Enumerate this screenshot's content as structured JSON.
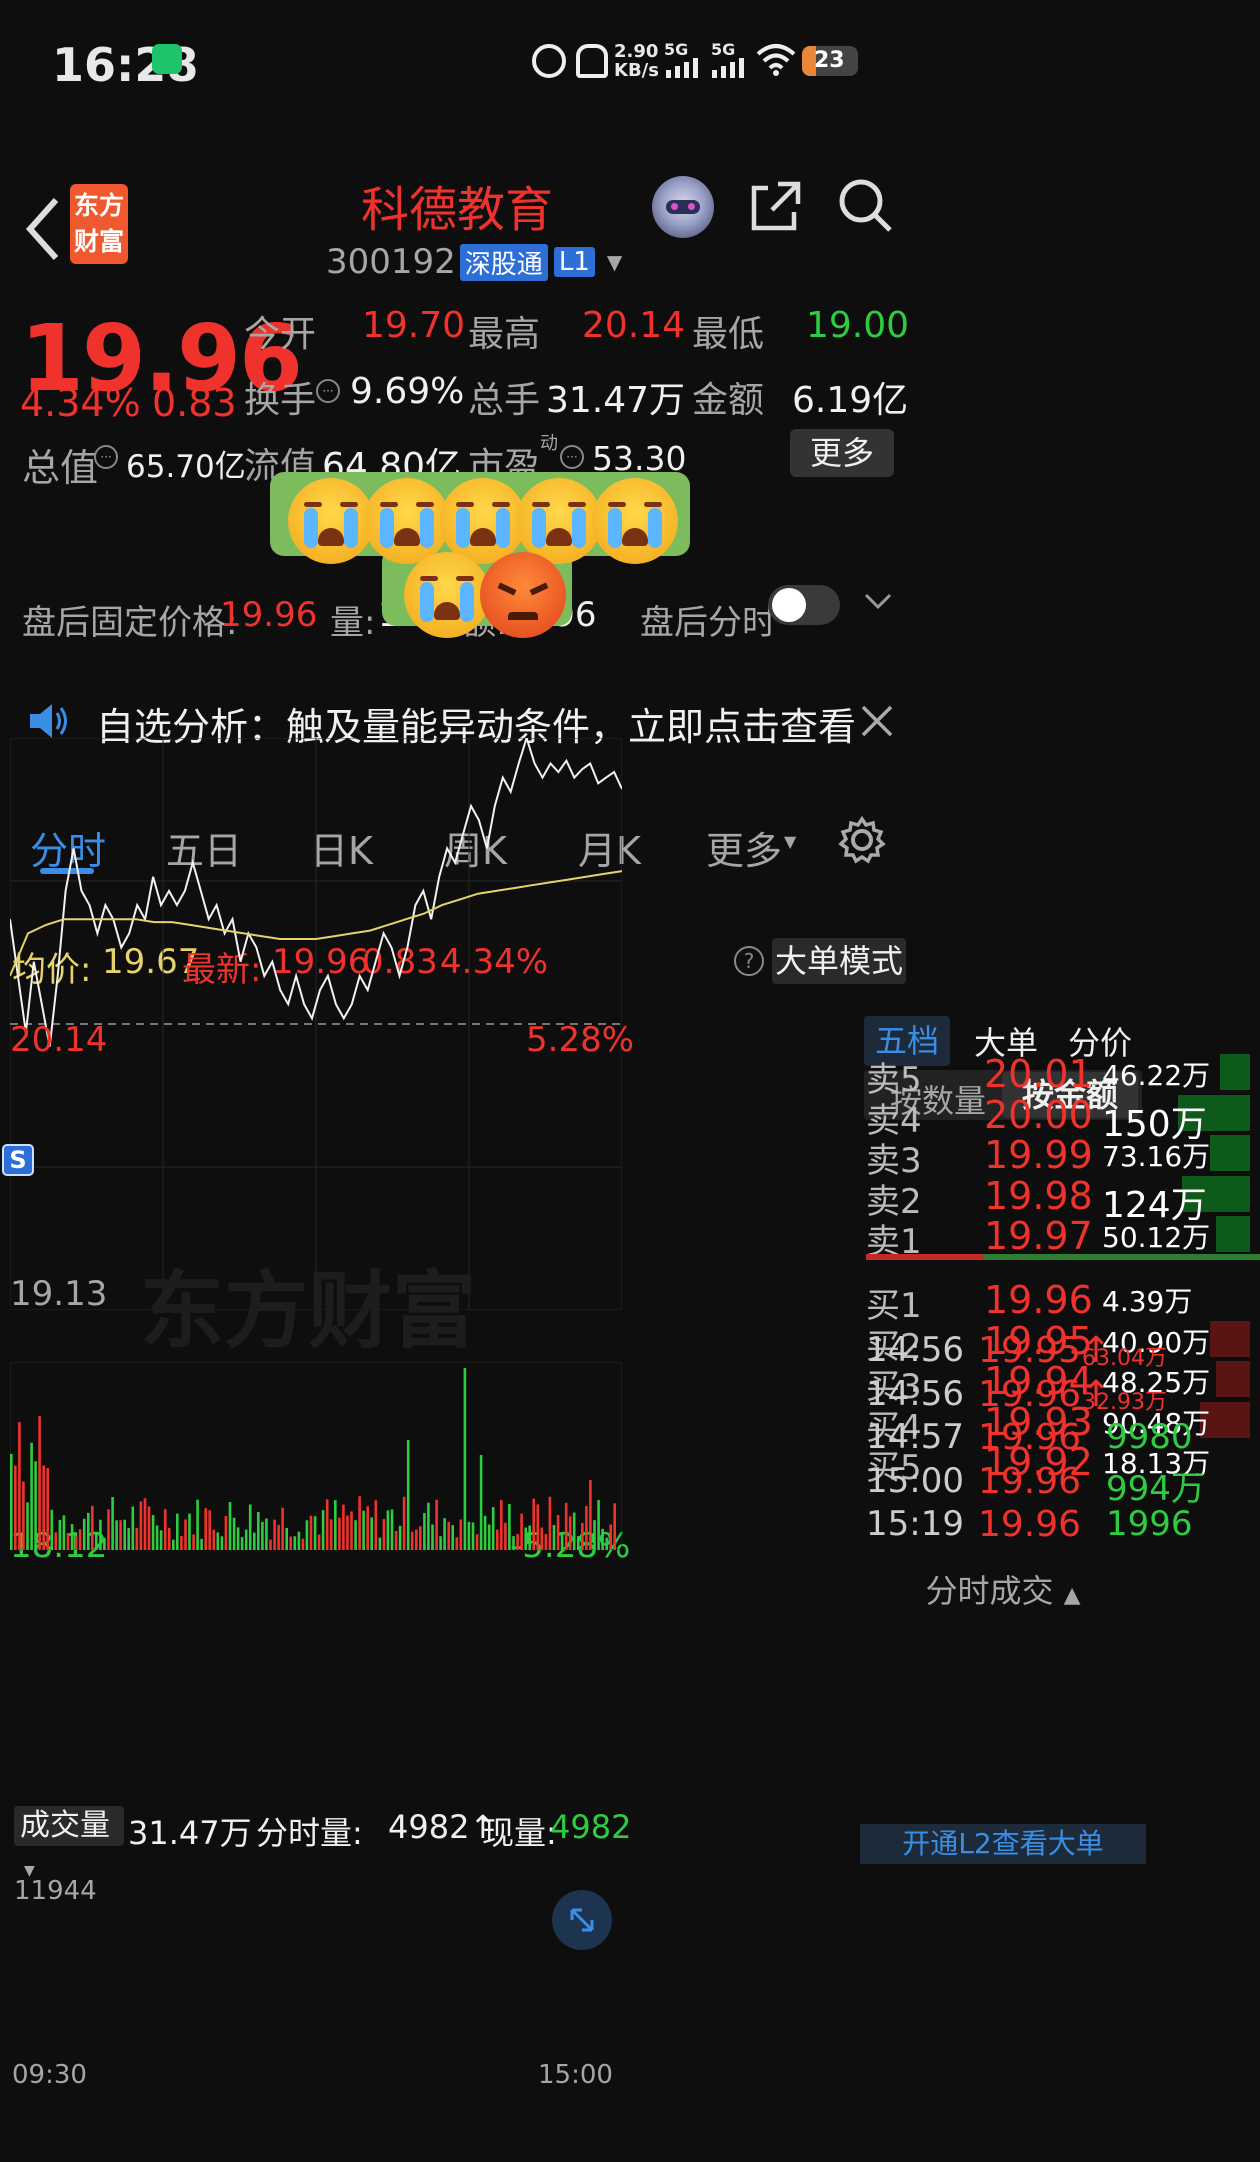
{
  "status": {
    "time": "16:28",
    "speed_top": "2.90",
    "speed_bottom": "KB/s",
    "net1": "5G",
    "net2": "5G",
    "battery": "23"
  },
  "header": {
    "logo_line1": "东方",
    "logo_line2": "财富",
    "stock_name": "科德教育",
    "stock_code": "300192",
    "tag_sgt": "深股通",
    "tag_l1": "L1"
  },
  "quote": {
    "price": "19.96",
    "pct": "4.34%",
    "change": "0.83",
    "open_label": "今开",
    "open": "19.70",
    "high_label": "最高",
    "high": "20.14",
    "low_label": "最低",
    "low": "19.00",
    "turnover_label": "换手",
    "turnover": "9.69%",
    "volume_label": "总手",
    "volume": "31.47万",
    "amount_label": "金额",
    "amount": "6.19亿",
    "mcap_label": "总值",
    "mcap": "65.70亿",
    "float_label": "流值",
    "float": "64.80亿",
    "pe_label": "市盈",
    "pe_sup": "动",
    "pe": "53.30",
    "more_label": "更多"
  },
  "after": {
    "label": "盘后固定价格:",
    "price": "19.96",
    "vol_label": "量:",
    "vol": "1",
    "amt_label": "额:",
    "amt": "1996",
    "time_label": "盘后分时"
  },
  "notice": {
    "text": "自选分析：触及量能异动条件，立即点击查看"
  },
  "tabs": {
    "t1": "分时",
    "t2": "五日",
    "t3": "日K",
    "t4": "周K",
    "t5": "月K",
    "t6": "更多"
  },
  "infobar": {
    "avg_label": "均价:",
    "avg": "19.67",
    "latest_label": "最新:",
    "latest": "19.96",
    "chg": "0.83",
    "pct": "4.34%",
    "mode": "大单模式"
  },
  "chart": {
    "max_price": "20.14",
    "max_pct": "5.28%",
    "ref_price": "19.13",
    "min_price": "18.12",
    "min_pct": "-5.28%",
    "marker": "S",
    "watermark": "东方财富"
  },
  "volbar": {
    "label": "成交量",
    "total": "31.47万",
    "fs_label": "分时量:",
    "fs": "4982↑",
    "now_label": "现量:",
    "now": "4982"
  },
  "vol": {
    "max": "11944",
    "time_start": "09:30",
    "time_end": "15:00"
  },
  "side": {
    "tab1": "五档",
    "tab2": "大单",
    "tab3": "分价",
    "seg1": "按数量",
    "seg2": "按金额",
    "sells": [
      {
        "label": "卖5",
        "price": "20.01",
        "amt": "46.22万"
      },
      {
        "label": "卖4",
        "price": "20.00",
        "amt": "150万"
      },
      {
        "label": "卖3",
        "price": "19.99",
        "amt": "73.16万"
      },
      {
        "label": "卖2",
        "price": "19.98",
        "amt": "124万"
      },
      {
        "label": "卖1",
        "price": "19.97",
        "amt": "50.12万"
      }
    ],
    "buys": [
      {
        "label": "买1",
        "price": "19.96",
        "amt": "4.39万"
      },
      {
        "label": "买2",
        "price": "19.95",
        "amt": "40.90万"
      },
      {
        "label": "买3",
        "price": "19.94",
        "amt": "48.25万"
      },
      {
        "label": "买4",
        "price": "19.93",
        "amt": "90.48万"
      },
      {
        "label": "买5",
        "price": "19.92",
        "amt": "18.13万"
      }
    ],
    "trades_title": "分时成交",
    "trades": [
      {
        "time": "14:56",
        "price": "19.95↑",
        "amt": "63.04万"
      },
      {
        "time": "14:56",
        "price": "19.96↑",
        "amt": "32.93万"
      },
      {
        "time": "14:57",
        "price": "19.96",
        "amt": "9980"
      },
      {
        "time": "15:00",
        "price": "19.96",
        "amt": "994万"
      },
      {
        "time": "15:19",
        "price": "19.96",
        "amt": "1996"
      }
    ],
    "footer": "开通L2查看大单"
  },
  "colors": {
    "up": "#f0322d",
    "down": "#2ecc40",
    "avg_line": "#e6d36a",
    "accent": "#3a8ee6",
    "sticker_bg": "#7cbc5d"
  },
  "chart_data": {
    "type": "line",
    "title": "",
    "y_range": [
      18.12,
      20.14
    ],
    "pct_range": [
      "-5.28%",
      "5.28%"
    ],
    "ref": 19.13,
    "series": [
      {
        "name": "",
        "values": [
          19.5,
          19.3,
          19.1,
          19.35,
          19.2,
          19.05,
          19.3,
          19.6,
          19.75,
          19.6,
          19.55,
          19.45,
          19.55,
          19.5,
          19.4,
          19.45,
          19.55,
          19.5,
          19.65,
          19.55,
          19.6,
          19.55,
          19.6,
          19.7,
          19.6,
          19.5,
          19.55,
          19.45,
          19.5,
          19.35,
          19.45,
          19.4,
          19.3,
          19.35,
          19.25,
          19.2,
          19.3,
          19.2,
          19.15,
          19.25,
          19.3,
          19.2,
          19.15,
          19.2,
          19.3,
          19.25,
          19.35,
          19.45,
          19.4,
          19.3,
          19.4,
          19.55,
          19.6,
          19.5,
          19.65,
          19.75,
          19.7,
          19.8,
          19.9,
          19.85,
          19.75,
          19.9,
          20.0,
          19.95,
          20.05,
          20.14,
          20.05,
          20.0,
          20.05,
          20.02,
          20.06,
          20.0,
          20.03,
          20.05,
          19.98,
          20.0,
          20.02,
          19.96
        ]
      },
      {
        "name": "",
        "values": [
          19.3,
          19.45,
          19.48,
          19.5,
          19.5,
          19.5,
          19.5,
          19.5,
          19.49,
          19.49,
          19.48,
          19.47,
          19.46,
          19.45,
          19.44,
          19.43,
          19.43,
          19.43,
          19.44,
          19.45,
          19.46,
          19.48,
          19.5,
          19.52,
          19.55,
          19.57,
          19.59,
          19.6,
          19.61,
          19.62,
          19.63,
          19.64,
          19.65,
          19.66,
          19.67
        ]
      }
    ]
  }
}
